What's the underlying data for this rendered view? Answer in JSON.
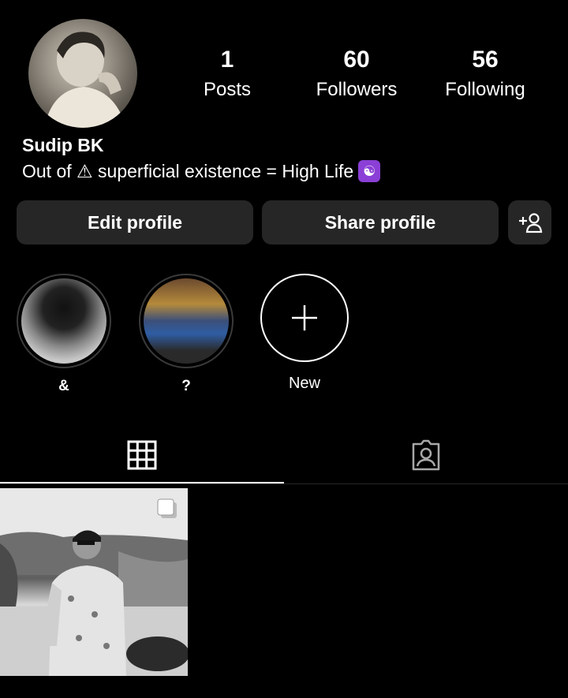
{
  "profile": {
    "name": "Sudip BK",
    "bio_text": "Out of ⚠ superficial existence = High Life",
    "bio_emoji": "☯"
  },
  "stats": {
    "posts": {
      "value": "1",
      "label": "Posts"
    },
    "followers": {
      "value": "60",
      "label": "Followers"
    },
    "following": {
      "value": "56",
      "label": "Following"
    }
  },
  "buttons": {
    "edit": "Edit profile",
    "share": "Share profile"
  },
  "highlights": [
    {
      "caption": "&"
    },
    {
      "caption": "?"
    },
    {
      "caption": "New"
    }
  ],
  "tabs": {
    "active": "grid",
    "items": [
      "grid-icon",
      "tagged-icon"
    ]
  },
  "icons": {
    "add_user": "add-user-icon",
    "plus": "plus-icon",
    "multi_post": "multiple-posts-icon"
  },
  "colors": {
    "background": "#000000",
    "button_bg": "#262626",
    "text": "#ffffff",
    "emoji_bg": "#8b3fd6"
  }
}
